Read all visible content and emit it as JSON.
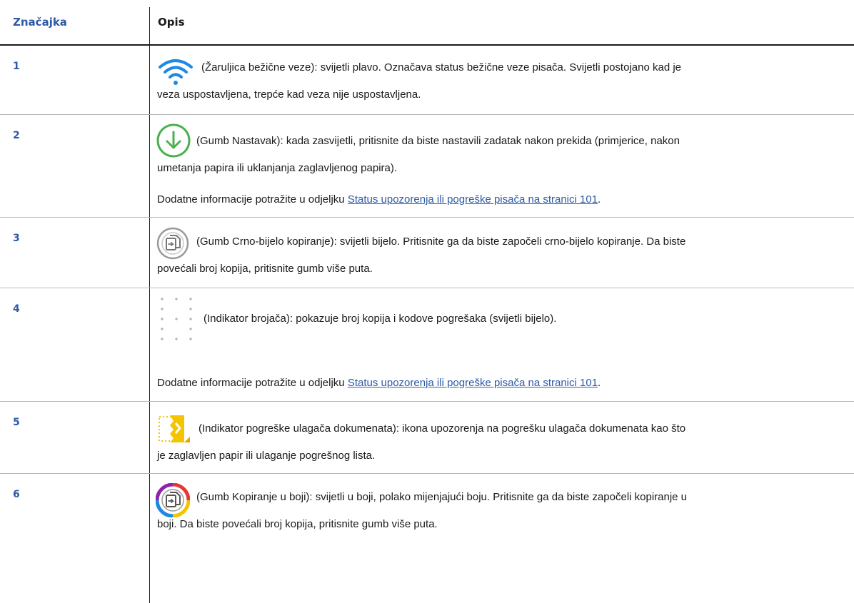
{
  "header": {
    "col1": "Značajka",
    "col2": "Opis"
  },
  "rows": [
    {
      "num": "1",
      "icon": "wifi-icon",
      "line1": "(Žaruljica bežične veze): svijetli plavo. Označava status bežične veze pisača. Svijetli postojano kad je",
      "line2": "veza uspostavljena, trepće kad veza nije uspostavljena."
    },
    {
      "num": "2",
      "icon": "resume-arrow-icon",
      "line1": "(Gumb Nastavak): kada zasvijetli, pritisnite da biste nastavili zadatak nakon prekida (primjerice, nakon",
      "line2": "umetanja papira ili uklanjanja zaglavljenog papira).",
      "note_prefix": "Dodatne informacije potražite u odjeljku ",
      "note_link": "Status upozorenja ili pogreške pisača na stranici 101",
      "note_suffix": "."
    },
    {
      "num": "3",
      "icon": "bw-copy-icon",
      "line1": "(Gumb Crno-bijelo kopiranje): svijetli bijelo. Pritisnite ga da biste započeli crno-bijelo kopiranje. Da biste",
      "line2": "povećali broj kopija, pritisnite gumb više puta."
    },
    {
      "num": "4",
      "icon": "counter-display-icon",
      "line1": "(Indikator brojača): pokazuje broj kopija i kodove pogrešaka (svijetli bijelo).",
      "note_prefix": "Dodatne informacije potražite u odjeljku ",
      "note_link": "Status upozorenja ili pogreške pisača na stranici 101",
      "note_suffix": "."
    },
    {
      "num": "5",
      "icon": "document-feeder-error-icon",
      "line1": "(Indikator pogreške ulagača dokumenata): ikona upozorenja na pogrešku ulagača dokumenata kao što",
      "line2": "je zaglavljen papir ili ulaganje pogrešnog lista."
    },
    {
      "num": "6",
      "icon": "color-copy-icon",
      "line1": "(Gumb Kopiranje u boji): svijetli u boji, polako mijenjajući boju. Pritisnite ga da biste započeli kopiranje u",
      "line2": "boji. Da biste povećali broj kopija, pritisnite gumb više puta."
    }
  ],
  "colors": {
    "accent": "#2d5aa6",
    "wifi": "#1e88e5",
    "resume": "#4caf50",
    "feeder": "#f5c400"
  }
}
